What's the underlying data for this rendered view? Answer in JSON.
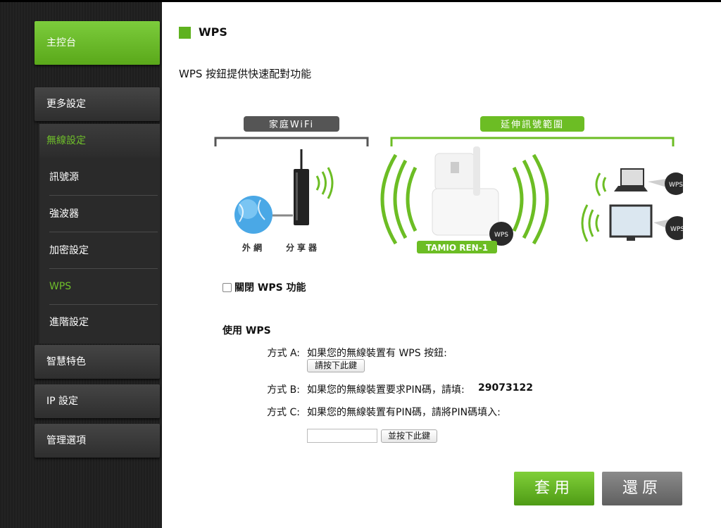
{
  "sidebar": {
    "main_label": "主控台",
    "more_settings": "更多設定",
    "wireless_settings": "無線設定",
    "sub_items": [
      {
        "label": "訊號源"
      },
      {
        "label": "強波器"
      },
      {
        "label": "加密設定"
      },
      {
        "label": "WPS"
      },
      {
        "label": "進階設定"
      }
    ],
    "smart_features": "智慧特色",
    "ip_settings": "IP 設定",
    "management": "管理選項"
  },
  "main": {
    "title": "WPS",
    "description": "WPS 按鈕提供快速配對功能",
    "diagram": {
      "home_wifi": "家庭WiFi",
      "extend_range": "延伸訊號範圍",
      "internet": "外  網",
      "router": "分享器",
      "device": "TAMIO REN-1",
      "wps_badge": "WPS"
    },
    "disable_wps": "關閉 WPS 功能",
    "use_wps": "使用 WPS",
    "method_a_label": "方式 A:",
    "method_a_text": "如果您的無線裝置有 WPS 按鈕:",
    "method_a_button": "請按下此鍵",
    "method_b_label": "方式 B:",
    "method_b_text": "如果您的無線裝置要求PIN碼，請填:",
    "method_b_pin": "29073122",
    "method_c_label": "方式 C:",
    "method_c_text": "如果您的無線裝置有PIN碼，請將PIN碼填入:",
    "method_c_input_value": "",
    "method_c_button": "並按下此鍵",
    "apply": "套用",
    "reset": "還原"
  },
  "colors": {
    "accent_green": "#5fb21f",
    "sidebar_bg": "#1e1e1e",
    "sub_active": "#6fbf2a"
  }
}
